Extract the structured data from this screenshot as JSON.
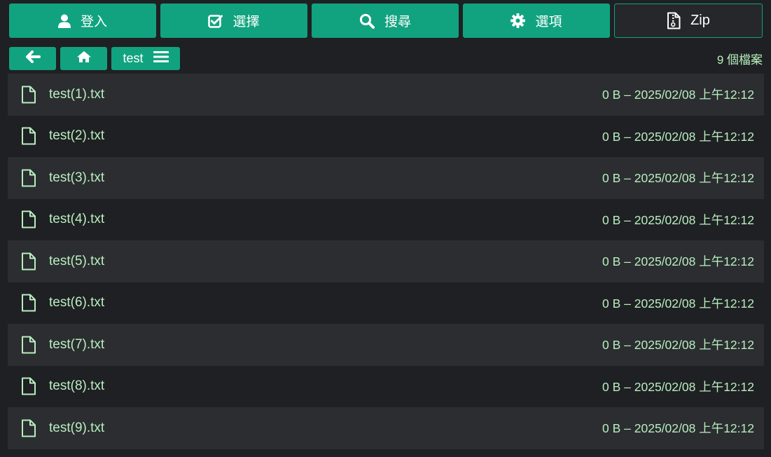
{
  "toolbar": {
    "login_label": "登入",
    "select_label": "選擇",
    "search_label": "搜尋",
    "options_label": "選項",
    "zip_label": "Zip"
  },
  "nav": {
    "folder_label": "test",
    "file_count": "9 個檔案"
  },
  "files": [
    {
      "name": "test(1).txt",
      "meta": "0 B – 2025/02/08 上午12:12"
    },
    {
      "name": "test(2).txt",
      "meta": "0 B – 2025/02/08 上午12:12"
    },
    {
      "name": "test(3).txt",
      "meta": "0 B – 2025/02/08 上午12:12"
    },
    {
      "name": "test(4).txt",
      "meta": "0 B – 2025/02/08 上午12:12"
    },
    {
      "name": "test(5).txt",
      "meta": "0 B – 2025/02/08 上午12:12"
    },
    {
      "name": "test(6).txt",
      "meta": "0 B – 2025/02/08 上午12:12"
    },
    {
      "name": "test(7).txt",
      "meta": "0 B – 2025/02/08 上午12:12"
    },
    {
      "name": "test(8).txt",
      "meta": "0 B – 2025/02/08 上午12:12"
    },
    {
      "name": "test(9).txt",
      "meta": "0 B – 2025/02/08 上午12:12"
    }
  ],
  "colors": {
    "accent": "#11a37f",
    "background": "#1f2023",
    "row_alt": "#2b2d30",
    "text": "#b8eec0"
  }
}
